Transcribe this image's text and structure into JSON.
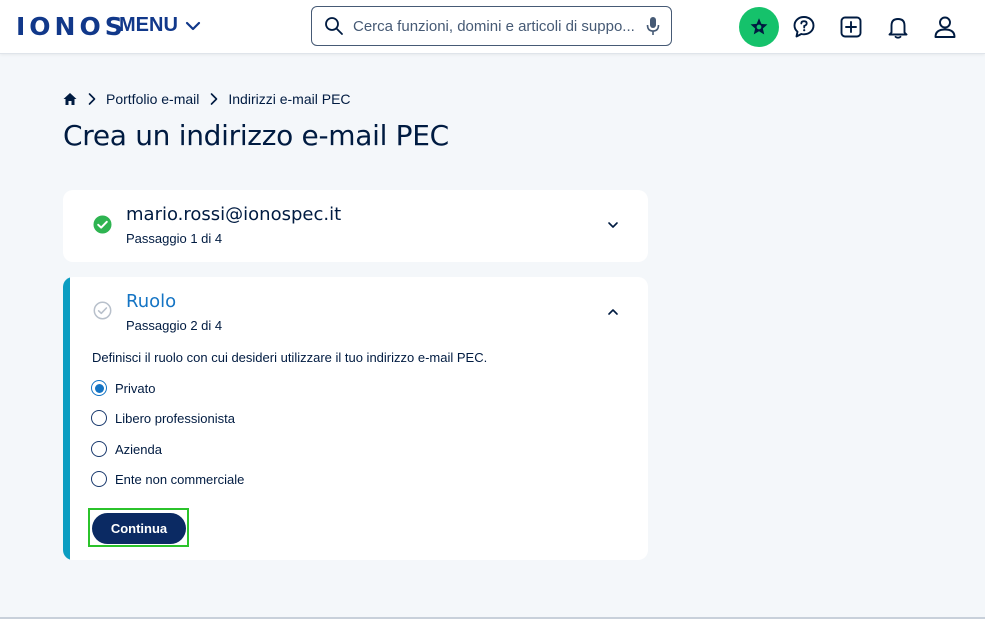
{
  "header": {
    "logo": "IONOS",
    "menu_label": "MENU",
    "search_placeholder": "Cerca funzioni, domini e articoli di suppo...",
    "icons": [
      "search-icon",
      "microphone-icon",
      "star-icon",
      "chat-help-icon",
      "plus-square-icon",
      "bell-icon",
      "user-icon"
    ]
  },
  "breadcrumb": {
    "items": [
      "Portfolio e-mail",
      "Indirizzi e-mail PEC"
    ]
  },
  "page_title": "Crea un indirizzo e-mail PEC",
  "steps": [
    {
      "title": "mario.rossi@ionospec.it",
      "subtitle": "Passaggio 1 di 4",
      "status": "completed"
    },
    {
      "title": "Ruolo",
      "subtitle": "Passaggio 2 di 4",
      "status": "active",
      "description": "Definisci il ruolo con cui desideri utilizzare il tuo indirizzo e-mail PEC.",
      "options": [
        {
          "label": "Privato",
          "selected": true
        },
        {
          "label": "Libero professionista",
          "selected": false
        },
        {
          "label": "Azienda",
          "selected": false
        },
        {
          "label": "Ente non commerciale",
          "selected": false
        }
      ],
      "button_label": "Continua"
    }
  ],
  "colors": {
    "brand": "#11388a",
    "accent": "#1474c4",
    "success": "#2eb451",
    "primary_button": "#0b2a63",
    "highlight": "#2bc32b"
  }
}
